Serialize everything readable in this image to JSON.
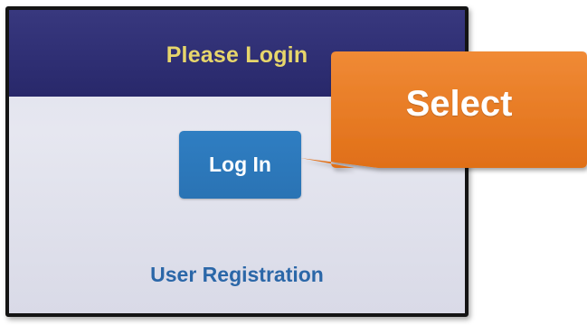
{
  "screen": {
    "header_title": "Please Login",
    "login_button_label": "Log In",
    "registration_link_label": "User Registration"
  },
  "annotation": {
    "callout_text": "Select",
    "callout_color": "#e97a22"
  },
  "colors": {
    "header_bg": "#2f2f74",
    "header_text": "#e7d66b",
    "button_bg": "#2f7ec2",
    "link_text": "#2b67a8"
  }
}
